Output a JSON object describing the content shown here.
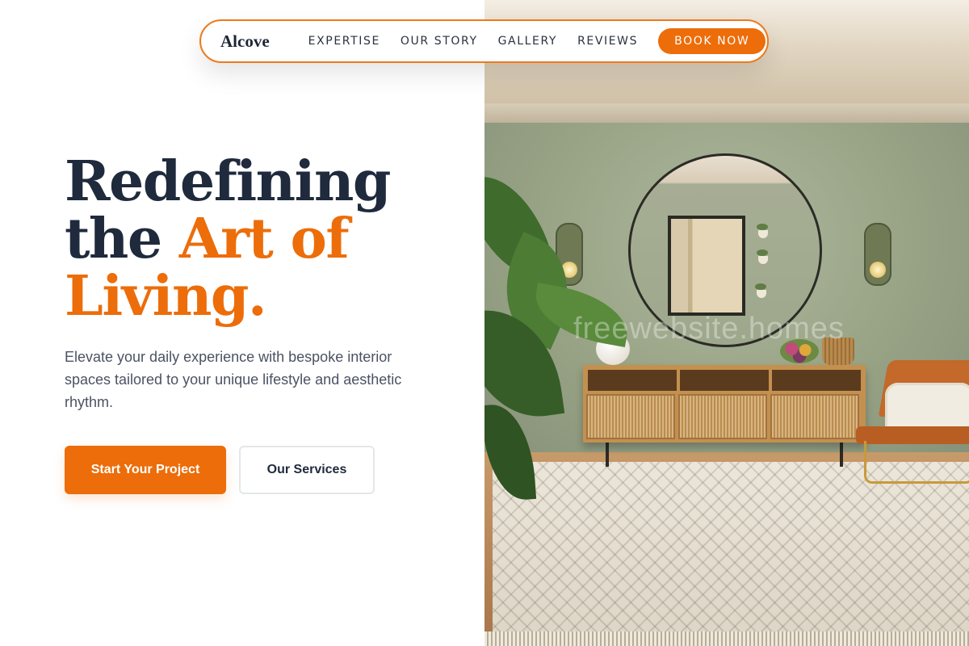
{
  "brand": {
    "logo": "Alcove",
    "accent_color": "#ec6d0a",
    "dark_color": "#1f2a3d"
  },
  "nav": {
    "links": [
      {
        "label": "EXPERTISE"
      },
      {
        "label": "OUR STORY"
      },
      {
        "label": "GALLERY"
      },
      {
        "label": "REVIEWS"
      }
    ],
    "cta_label": "BOOK NOW"
  },
  "hero": {
    "title_line1": "Redefining",
    "title_line2_dark": "the",
    "title_line2_accent": "Art of",
    "title_line3_accent": "Living.",
    "subtitle": "Elevate your daily experience with bespoke interior spaces tailored to your unique lifestyle and aesthetic rhythm.",
    "primary_button": "Start Your Project",
    "secondary_button": "Our Services"
  },
  "photo": {
    "watermark": "freewebsite.homes"
  }
}
